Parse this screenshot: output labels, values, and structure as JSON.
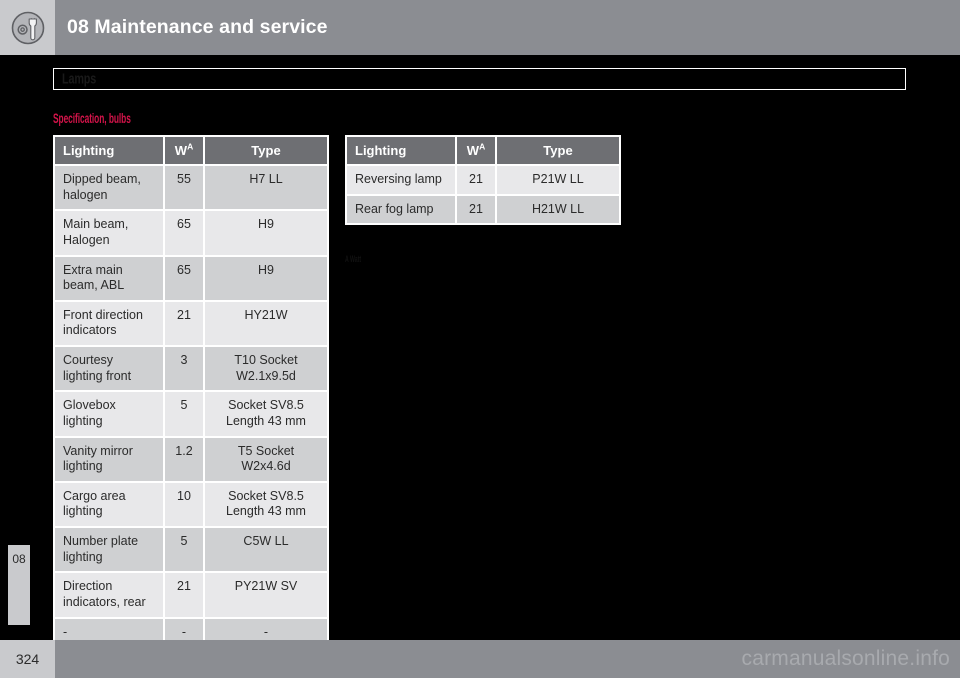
{
  "header": {
    "chapter_title": "08 Maintenance and service",
    "icon": "wrench-gear-icon"
  },
  "section": {
    "bar_label": "Lamps",
    "sub_heading": "Specification, bulbs"
  },
  "tables": {
    "left": {
      "columns": [
        "Lighting",
        "W",
        "Type"
      ],
      "w_superscript": "A",
      "rows": [
        {
          "lighting": "Dipped beam, halogen",
          "w": "55",
          "type": "H7 LL"
        },
        {
          "lighting": "Main beam, Halogen",
          "w": "65",
          "type": "H9"
        },
        {
          "lighting": "Extra main beam, ABL",
          "w": "65",
          "type": "H9"
        },
        {
          "lighting": "Front direction indicators",
          "w": "21",
          "type": "HY21W"
        },
        {
          "lighting": "Courtesy lighting front",
          "w": "3",
          "type": "T10 Socket W2.1x9.5d"
        },
        {
          "lighting": "Glovebox lighting",
          "w": "5",
          "type": "Socket SV8.5 Length 43 mm"
        },
        {
          "lighting": "Vanity mirror lighting",
          "w": "1.2",
          "type": "T5 Socket W2x4.6d"
        },
        {
          "lighting": "Cargo area lighting",
          "w": "10",
          "type": "Socket SV8.5 Length 43 mm"
        },
        {
          "lighting": "Number plate lighting",
          "w": "5",
          "type": "C5W LL"
        },
        {
          "lighting": "Direction indicators, rear",
          "w": "21",
          "type": "PY21W SV"
        },
        {
          "lighting": "-",
          "w": "-",
          "type": "-"
        }
      ]
    },
    "right": {
      "columns": [
        "Lighting",
        "W",
        "Type"
      ],
      "w_superscript": "A",
      "rows": [
        {
          "lighting": "Reversing lamp",
          "w": "21",
          "type": "P21W LL"
        },
        {
          "lighting": "Rear fog lamp",
          "w": "21",
          "type": "H21W LL"
        }
      ]
    }
  },
  "footnote": "A Watt",
  "chapter_tab": "08",
  "footer": {
    "page_number": "324",
    "watermark": "carmanualsonline.info"
  },
  "colors": {
    "header_gray": "#8b8d92",
    "light_gray": "#c9cacd",
    "table_header": "#6e6f73",
    "row_odd": "#e8e8ea",
    "row_even": "#cfd0d2",
    "accent_red": "#d4144a",
    "page_bg": "#000000"
  }
}
